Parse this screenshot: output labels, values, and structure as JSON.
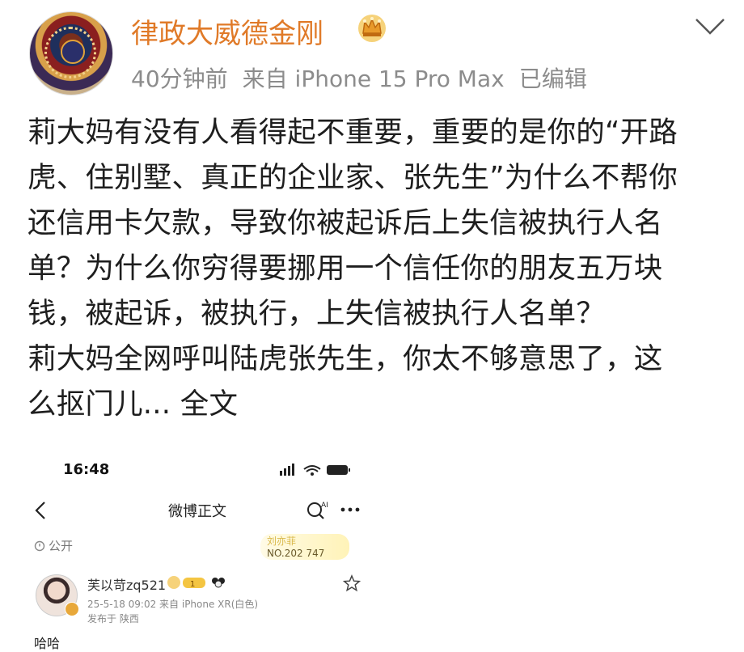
{
  "post": {
    "username": "律政大威德金刚",
    "meta": {
      "time": "40分钟前",
      "source": "来自 iPhone 15 Pro Max",
      "edited": "已编辑"
    },
    "body_lines": [
      "莉大妈有没有人看得起不重要，重要的是你的“开路",
      "虎、住别墅、真正的企业家、张先生”为什么不帮你",
      "还信用卡欠款，导致你被起诉后上失信被执行人名",
      "单？为什么你穷得要挪用一个信任你的朋友五万块",
      "钱，被起诉，被执行，上失信被执行人名单？",
      "莉大妈全网呼叫陆虎张先生，你太不够意思了，这"
    ],
    "last_line": "么抠门儿...",
    "full_text_link": "全文",
    "icons": {
      "crown": "crown-icon",
      "chevron": "chevron-down-icon"
    },
    "accent_color": "#e07a28"
  },
  "embedded_screenshot": {
    "status_time": "16:48",
    "nav_title": "微博正文",
    "visibility": "公开",
    "stamp_line1": "刘亦菲",
    "stamp_line2": "NO.202 747",
    "author": {
      "name": "芙以苛zq521",
      "date_source": "25-5-18 09:02  来自 iPhone XR(白色)",
      "location": "发布于 陕西"
    },
    "content_start": "哈哈"
  }
}
